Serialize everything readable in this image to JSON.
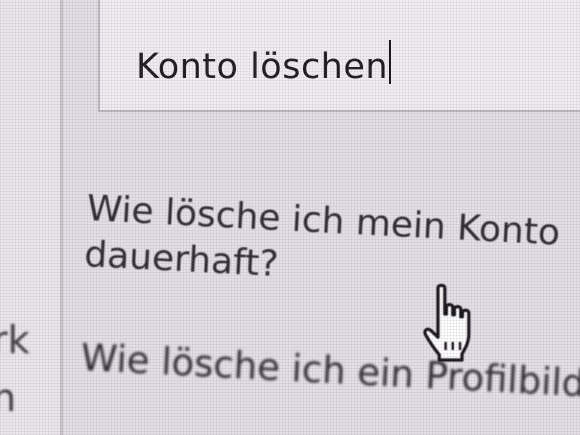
{
  "search": {
    "value": "Konto löschen"
  },
  "suggestions": [
    {
      "line1": "Wie lösche ich mein Konto",
      "line2": "dauerhaft?"
    },
    {
      "line1": "Wie lösche ich ein Profilbild?"
    }
  ],
  "left_pane": {
    "cut_text_1": "rk",
    "cut_text_2": "n"
  },
  "icons": {
    "cursor": "hand-pointer-icon"
  },
  "colors": {
    "text": "#2c292f",
    "background": "#e4e0e5"
  }
}
